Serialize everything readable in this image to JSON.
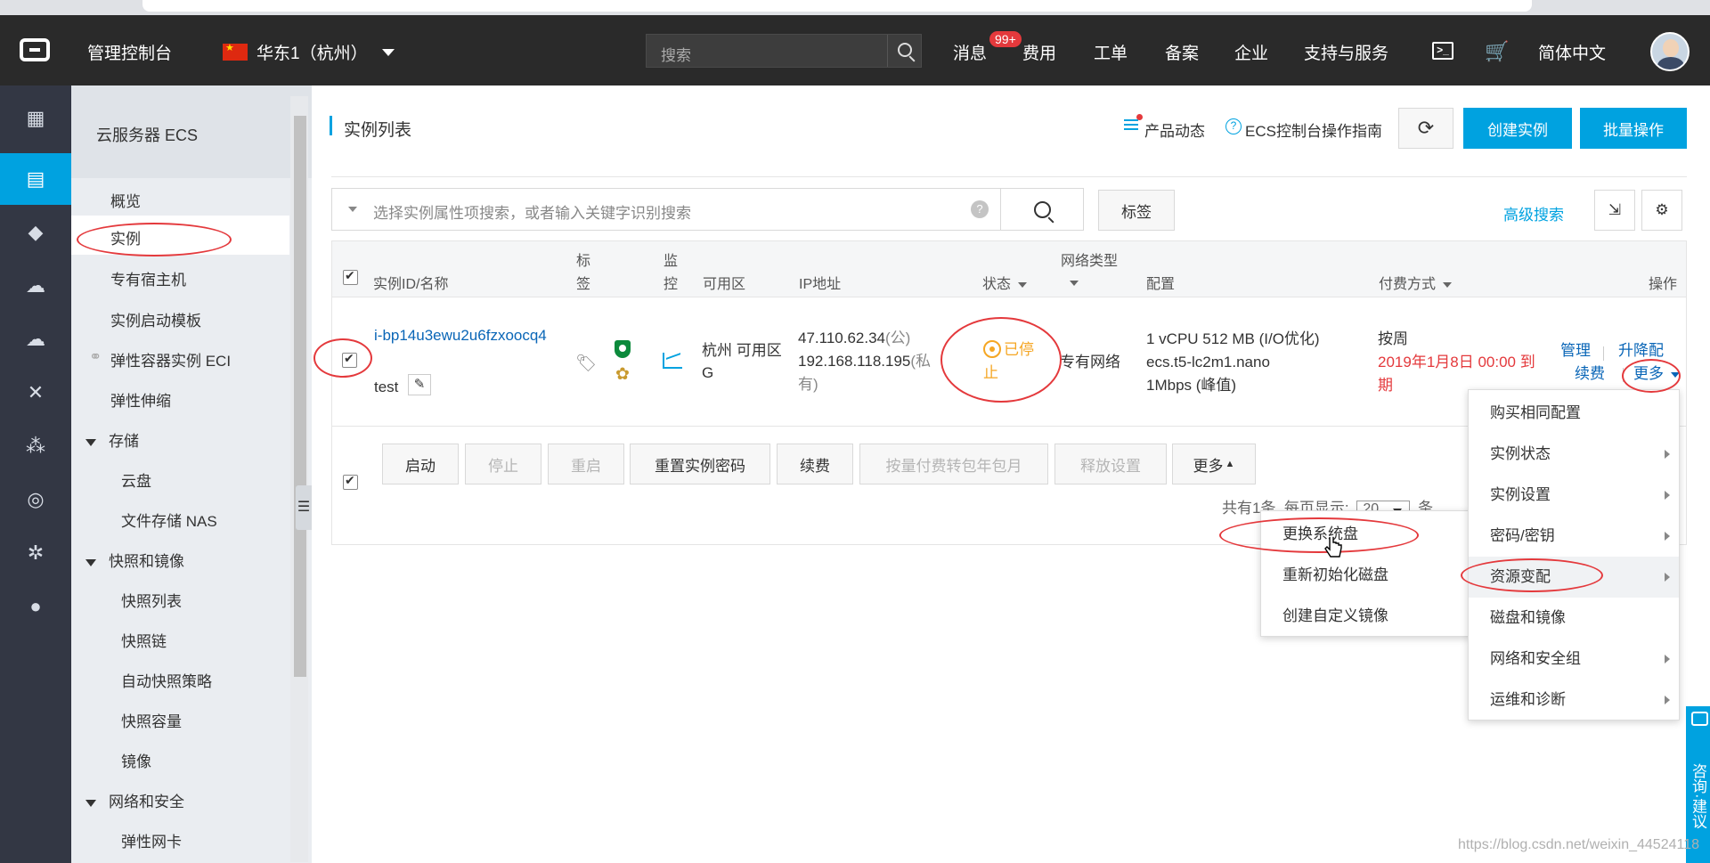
{
  "topbar": {
    "console": "管理控制台",
    "region": "华东1（杭州）",
    "search_placeholder": "搜索",
    "items": [
      "消息",
      "费用",
      "工单",
      "备案",
      "企业",
      "支持与服务",
      "简体中文"
    ],
    "badge": "99+"
  },
  "nav": {
    "title": "云服务器 ECS",
    "items": [
      "概览",
      "实例",
      "专有宿主机",
      "实例启动模板",
      "弹性容器实例 ECI",
      "弹性伸缩"
    ],
    "storage": {
      "label": "存储",
      "items": [
        "云盘",
        "文件存储 NAS"
      ]
    },
    "snapshot": {
      "label": "快照和镜像",
      "items": [
        "快照列表",
        "快照链",
        "自动快照策略",
        "快照容量",
        "镜像"
      ]
    },
    "network": {
      "label": "网络和安全",
      "items": [
        "弹性网卡"
      ]
    }
  },
  "header": {
    "title": "实例列表",
    "product_news": "产品动态",
    "guide": "ECS控制台操作指南",
    "create_label": "创建实例",
    "batch_label": "批量操作"
  },
  "filter": {
    "placeholder": "选择实例属性项搜索，或者输入关键字识别搜索",
    "tag_label": "标签",
    "advanced_label": "高级搜索"
  },
  "table": {
    "headers": {
      "id": "实例ID/名称",
      "tag_1": "标",
      "tag_2": "签",
      "monitor_1": "监",
      "monitor_2": "控",
      "zone": "可用区",
      "ip": "IP地址",
      "status": "状态",
      "net": "网络类型",
      "config": "配置",
      "pay": "付费方式",
      "ops": "操作"
    },
    "row": {
      "id": "i-bp14u3ewu2u6fzxoocq4",
      "name": "test",
      "zone_1": "杭州 可用区",
      "zone_2": "G",
      "ip_public": "47.110.62.34",
      "ip_public_suffix": "(公)",
      "ip_private": "192.168.118.195",
      "ip_private_suffix_1": "(私",
      "ip_private_suffix_2": "有)",
      "status_1": "已停",
      "status_2": "止",
      "net": "专有网络",
      "config_1": "1 vCPU 512 MB (I/O优化)",
      "config_2": "ecs.t5-lc2m1.nano",
      "config_3": "1Mbps (峰值)",
      "pay_1": "按周",
      "pay_2": "2019年1月8日 00:00 到",
      "pay_3": "期",
      "op_manage": "管理",
      "op_upgrade": "升降配",
      "op_renew": "续费",
      "op_more": "更多"
    }
  },
  "batch": {
    "start": "启动",
    "stop": "停止",
    "restart": "重启",
    "reset_pwd": "重置实例密码",
    "renew": "续费",
    "convert": "按量付费转包年包月",
    "release": "释放设置",
    "more": "更多",
    "pager_total": "共有1条, 每页显示:",
    "pager_size": "20",
    "pager_unit": "条"
  },
  "more_menu": [
    "购买相同配置",
    "实例状态",
    "实例设置",
    "密码/密钥",
    "资源变配",
    "磁盘和镜像",
    "网络和安全组",
    "运维和诊断"
  ],
  "sub_menu": [
    "更换系统盘",
    "重新初始化磁盘",
    "创建自定义镜像"
  ],
  "consult": "咨询·建议",
  "watermark": "https://blog.csdn.net/weixin_44524118"
}
